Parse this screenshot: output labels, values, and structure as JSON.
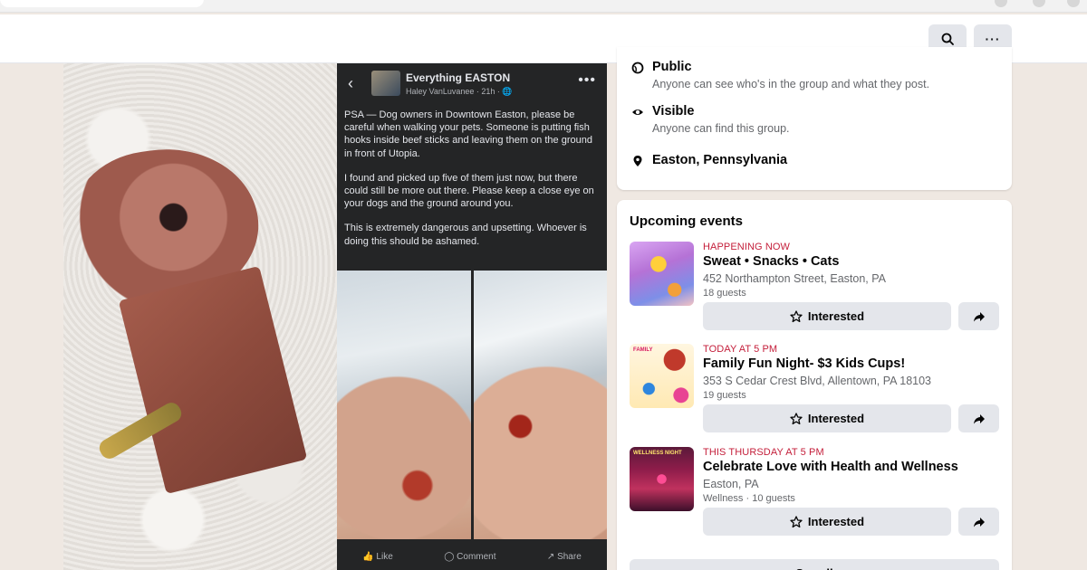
{
  "colors": {
    "accent_red": "#c41e3a",
    "button_gray": "#e4e6eb",
    "text_secondary": "#65676b",
    "page_bg": "#efe8e2"
  },
  "header": {
    "search_icon": "search-icon",
    "more_icon": "more-icon",
    "more_glyph": "···"
  },
  "post_screenshot": {
    "back_glyph": "‹",
    "more_glyph": "•••",
    "group_name": "Everything EASTON",
    "author_line": "Haley VanLuvanee · 21h · 🌐",
    "paragraphs": [
      "PSA — Dog owners in Downtown Easton, please be careful when walking your pets. Someone is putting fish hooks inside beef sticks and leaving them on the ground in front of Utopia.",
      "I found and picked up five of them just now, but there could still be more out there. Please keep a close eye on your dogs and the ground around you.",
      "This is extremely dangerous and upsetting. Whoever is doing this should be ashamed."
    ],
    "actions": {
      "like": "👍 Like",
      "comment": "◯ Comment",
      "share": "↗ Share"
    }
  },
  "about": {
    "public_title": "Public",
    "public_desc": "Anyone can see who's in the group and what they post.",
    "visible_title": "Visible",
    "visible_desc": "Anyone can find this group.",
    "location": "Easton, Pennsylvania"
  },
  "events": {
    "title": "Upcoming events",
    "interested_label": "Interested",
    "see_all_label": "See all",
    "items": [
      {
        "status": "HAPPENING NOW",
        "name": "Sweat • Snacks • Cats",
        "location": "452 Northampton Street, Easton, PA",
        "guests": "18 guests",
        "thumb_text": ""
      },
      {
        "status": "TODAY AT 5 PM",
        "name": "Family Fun Night- $3 Kids Cups!",
        "location": "353 S Cedar Crest Blvd, Allentown, PA 18103",
        "guests": "19 guests",
        "thumb_text": "FAMILY"
      },
      {
        "status": "THIS THURSDAY AT 5 PM",
        "name": "Celebrate Love with Health and Wellness",
        "location": "Easton, PA",
        "guests": "Wellness · 10 guests",
        "thumb_text": "WELLNESS NIGHT"
      }
    ]
  }
}
